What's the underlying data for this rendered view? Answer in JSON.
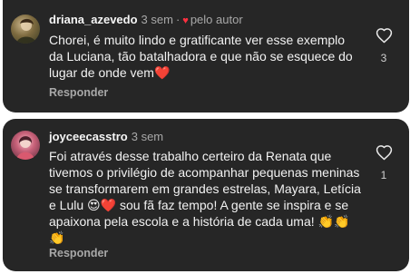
{
  "colors": {
    "card_bg": "#262626",
    "text": "#f2f2f2",
    "muted": "#a8a8a8",
    "heart": "#ff3040"
  },
  "comments": [
    {
      "username": "driana_azevedo",
      "time": "3 sem",
      "separator": "·",
      "author_heart_icon": "heart-icon",
      "liked_by_author": "pelo autor",
      "text": "Chorei, é muito lindo e gratificante ver esse exemplo da Luciana, tão batalhadora e que não se esquece do lugar de onde vem❤️",
      "reply_label": "Responder",
      "like_icon": "heart-outline-icon",
      "likes": "3"
    },
    {
      "username": "joyceecasstro",
      "time": "3 sem",
      "text": "Foi através desse trabalho certeiro da Renata que tivemos o privilégio de acompanhar pequenas meninas se transformarem em grandes estrelas, Mayara, Letícia e Lulu 😍❤️ sou fã faz tempo! A gente se inspira e se apaixona pela escola e a história de cada uma! 👏👏👏",
      "reply_label": "Responder",
      "like_icon": "heart-outline-icon",
      "likes": "1"
    }
  ]
}
